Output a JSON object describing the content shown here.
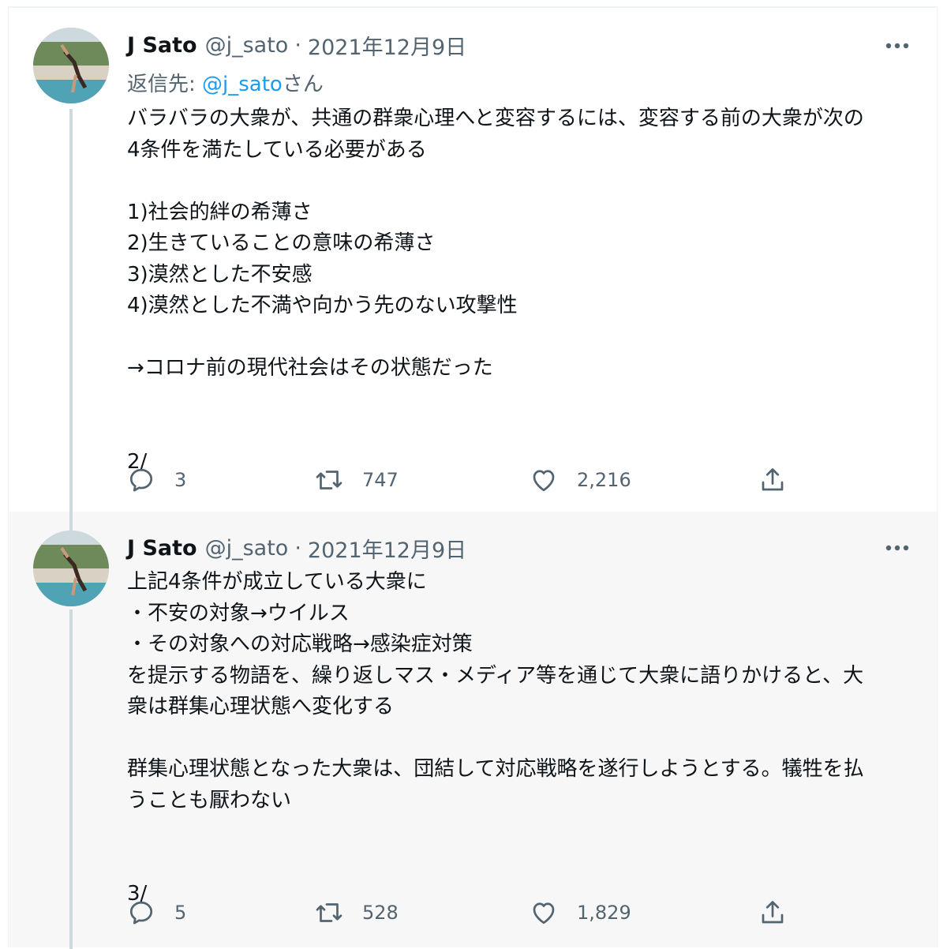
{
  "tweets": [
    {
      "display_name": "J Sato",
      "handle": "@j_sato",
      "separator": "·",
      "date": "2021年12月9日",
      "reply_label": "返信先: ",
      "reply_mention": "@j_sato",
      "reply_suffix": "さん",
      "text": "バラバラの大衆が、共通の群衆心理へと変容するには、変容する前の大衆が次の\n4条件を満たしている必要がある\n\n1)社会的絆の希薄さ\n2)生きていることの意味の希薄さ\n3)漠然とした不安感\n4)漠然とした不満や向かう先のない攻撃性\n\n→コロナ前の現代社会はその状態だった\n\n\n2/",
      "replies": "3",
      "retweets": "747",
      "likes": "2,216"
    },
    {
      "display_name": "J Sato",
      "handle": "@j_sato",
      "separator": "·",
      "date": "2021年12月9日",
      "text": "上記4条件が成立している大衆に\n・不安の対象→ウイルス\n・その対象への対応戦略→感染症対策\nを提示する物語を、繰り返しマス・メディア等を通じて大衆に語りかけると、大\n衆は群集心理状態へ変化する\n\n群集心理状態となった大衆は、団結して対応戦略を遂行しようとする。犠牲を払\nうことも厭わない\n\n\n3/",
      "replies": "5",
      "retweets": "528",
      "likes": "1,829"
    }
  ],
  "icons": [
    "more-icon",
    "reply-icon",
    "retweet-icon",
    "like-icon",
    "share-icon"
  ],
  "colors": {
    "text": "#0f1419",
    "secondary": "#536471",
    "link": "#1d9bf0",
    "thread": "#cfd9de",
    "selected_bg": "#f7f7f7"
  }
}
